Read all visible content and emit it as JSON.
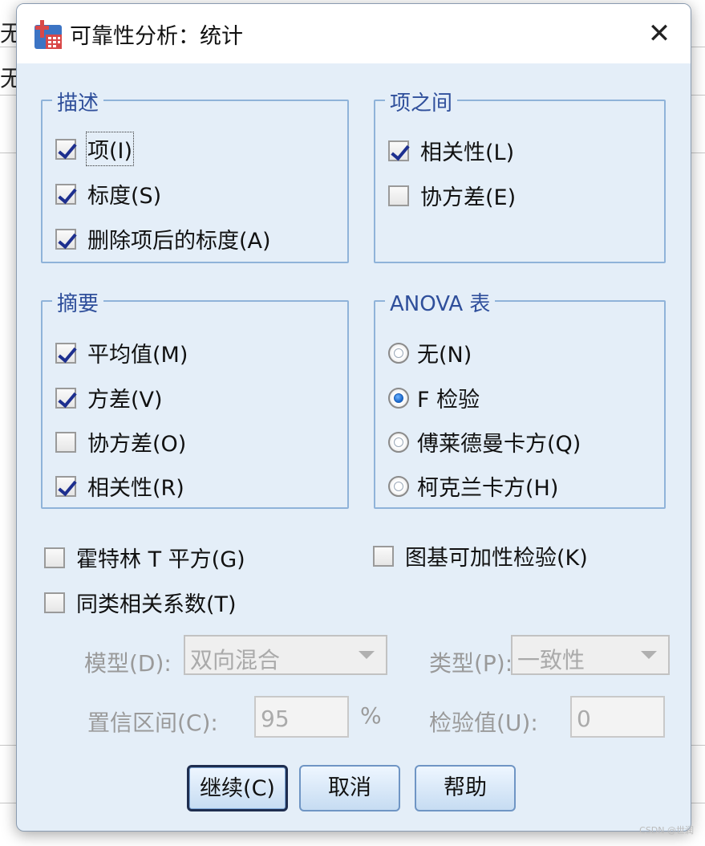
{
  "title": "可靠性分析：统计",
  "close_glyph": "✕",
  "background": {
    "cell_text_1": "无",
    "cell_text_2": "无"
  },
  "descriptives": {
    "legend": "描述",
    "items": [
      {
        "label": "项(I)",
        "checked": true
      },
      {
        "label": "标度(S)",
        "checked": true
      },
      {
        "label": "删除项后的标度(A)",
        "checked": true
      }
    ]
  },
  "inter_item": {
    "legend": "项之间",
    "items": [
      {
        "label": "相关性(L)",
        "checked": true
      },
      {
        "label": "协方差(E)",
        "checked": false
      }
    ]
  },
  "summaries": {
    "legend": "摘要",
    "items": [
      {
        "label": "平均值(M)",
        "checked": true
      },
      {
        "label": "方差(V)",
        "checked": true
      },
      {
        "label": "协方差(O)",
        "checked": false
      },
      {
        "label": "相关性(R)",
        "checked": true
      }
    ]
  },
  "anova": {
    "legend": "ANOVA 表",
    "options": [
      {
        "label": "无(N)",
        "selected": false
      },
      {
        "label": "F 检验",
        "selected": true
      },
      {
        "label": "傅莱德曼卡方(Q)",
        "selected": false
      },
      {
        "label": "柯克兰卡方(H)",
        "selected": false
      }
    ]
  },
  "hotelling": {
    "label": "霍特林 T 平方(G)",
    "checked": false
  },
  "tukey": {
    "label": "图基可加性检验(K)",
    "checked": false
  },
  "icc": {
    "label": "同类相关系数(T)",
    "checked": false,
    "model_label": "模型(D):",
    "model_value": "双向混合",
    "type_label": "类型(P):",
    "type_value": "一致性",
    "ci_label": "置信区间(C):",
    "ci_value": "95",
    "ci_unit": "%",
    "test_label": "检验值(U):",
    "test_value": "0"
  },
  "buttons": {
    "continue": "继续(C)",
    "cancel": "取消",
    "help": "帮助"
  },
  "watermark": "CSDN @世润",
  "colors": {
    "legend": "#2f4f9b",
    "group_border": "#8fb3d9",
    "dialog_bg": "#e4eef8",
    "check": "#1d2f8f"
  }
}
